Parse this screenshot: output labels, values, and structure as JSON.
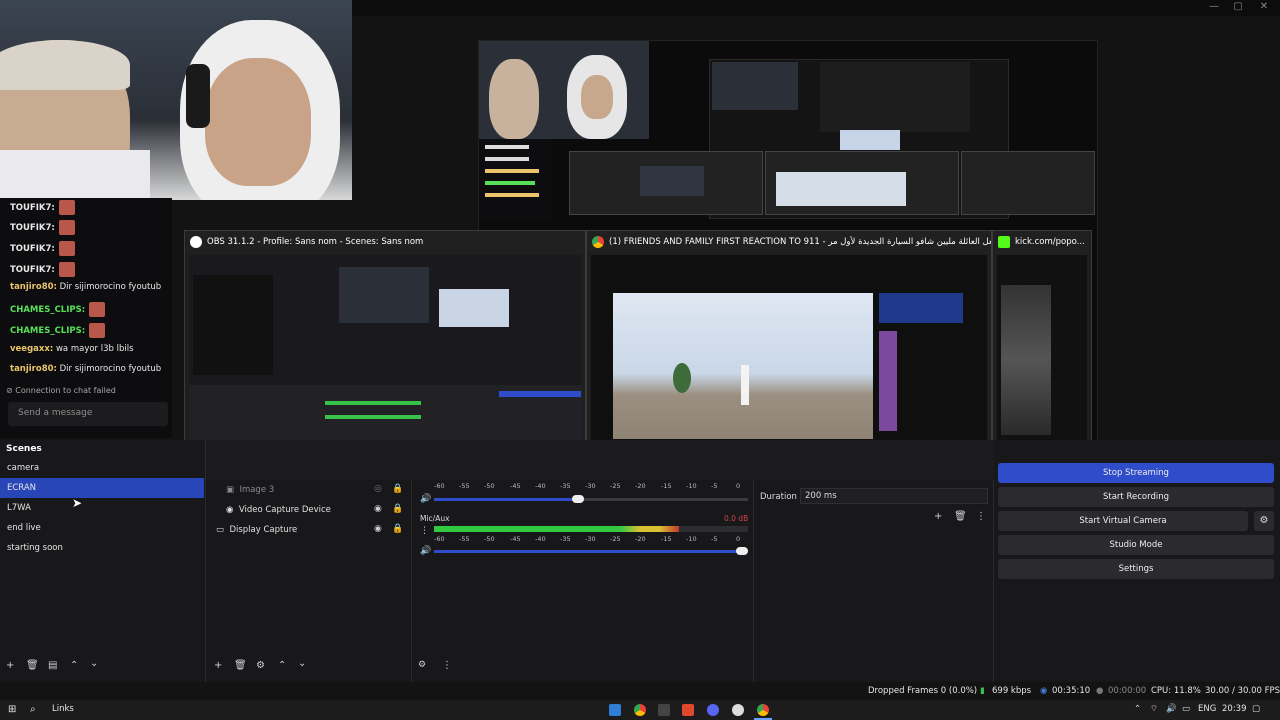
{
  "chat": {
    "messages": [
      {
        "user": "TOUFIK7:",
        "text": "",
        "emote": true,
        "color": "#ffffff"
      },
      {
        "user": "TOUFIK7:",
        "text": "",
        "emote": true,
        "color": "#ffffff"
      },
      {
        "user": "TOUFIK7:",
        "text": "",
        "emote": true,
        "color": "#ffffff"
      },
      {
        "user": "TOUFIK7:",
        "text": "",
        "emote": true,
        "color": "#ffffff"
      },
      {
        "user": "tanjiro80:",
        "text": "Dir sijimorocino fyoutub",
        "emote": false,
        "color": "#e9c46a"
      },
      {
        "user": "CHAMES_CLIPS:",
        "text": "",
        "emote": true,
        "color": "#57e057"
      },
      {
        "user": "CHAMES_CLIPS:",
        "text": "",
        "emote": true,
        "color": "#57e057"
      },
      {
        "user": "veegaxx:",
        "text": "wa mayor l3b lbils",
        "emote": false,
        "color": "#e9c46a"
      },
      {
        "user": "tanjiro80:",
        "text": "Dir sijimorocino fyoutub",
        "emote": false,
        "color": "#e9c46a"
      }
    ],
    "status": "Connection to chat failed",
    "input_placeholder": "Send a message"
  },
  "taskbar_previews": [
    {
      "title": "OBS 31.1.2 - Profile: Sans nom - Scenes: Sans nom",
      "icon_color": "#ffffff"
    },
    {
      "title": "(1) FRIENDS AND FAMILY FIRST REACTION TO 911 - ردة فعل العائلة مليين شافو السيارة الجديدة لأول مر...",
      "icon_color": "#ffffff"
    },
    {
      "title": "kick.com/popo...",
      "icon_color": "#53fc18"
    }
  ],
  "scenes": {
    "title": "Scenes",
    "items": [
      "camera",
      "ECRAN",
      "L7WA",
      "end live",
      "starting soon"
    ],
    "active_index": 1
  },
  "sources": {
    "items": [
      {
        "label": "Image 3",
        "dim": true
      },
      {
        "label": "Video Capture Device",
        "dim": false
      },
      {
        "label": "Display Capture",
        "dim": false
      }
    ]
  },
  "audio_mixer": {
    "channel1": {
      "ticks": [
        "-60",
        "-55",
        "-50",
        "-45",
        "-40",
        "-35",
        "-30",
        "-25",
        "-20",
        "-15",
        "-10",
        "-5",
        "0"
      ]
    },
    "channel2": {
      "name": "Mic/Aux",
      "level": "0.0 dB",
      "ticks": [
        "-60",
        "-55",
        "-50",
        "-45",
        "-40",
        "-35",
        "-30",
        "-25",
        "-20",
        "-15",
        "-10",
        "-5",
        "0"
      ],
      "fill": 0.78
    }
  },
  "transitions": {
    "duration_label": "Duration",
    "duration_value": "200 ms"
  },
  "controls": {
    "stop_streaming": "Stop Streaming",
    "start_recording": "Start Recording",
    "start_virtual_camera": "Start Virtual Camera",
    "studio_mode": "Studio Mode",
    "settings": "Settings"
  },
  "status": {
    "dropped_frames": "Dropped Frames 0 (0.0%)",
    "bitrate": "699 kbps",
    "stream_time": "00:35:10",
    "rec_time": "00:00:00",
    "cpu": "CPU: 11.8%",
    "fps": "30.00 / 30.00 FPS"
  },
  "windows_taskbar": {
    "links": "Links",
    "lang": "ENG",
    "time": "20:39"
  }
}
